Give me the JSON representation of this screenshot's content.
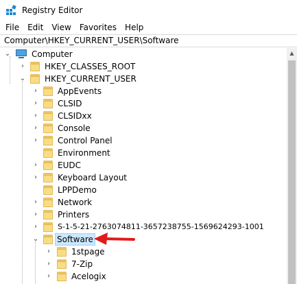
{
  "window": {
    "title": "Registry Editor"
  },
  "menu": [
    "File",
    "Edit",
    "View",
    "Favorites",
    "Help"
  ],
  "address": "Computer\\HKEY_CURRENT_USER\\Software",
  "tree": {
    "root": {
      "label": "Computer",
      "expanded": true
    },
    "hives": [
      {
        "label": "HKEY_CLASSES_ROOT",
        "expanded": false
      },
      {
        "label": "HKEY_CURRENT_USER",
        "expanded": true
      }
    ],
    "hkcu_children": [
      {
        "label": "AppEvents",
        "expanded": false
      },
      {
        "label": "CLSID",
        "expanded": false
      },
      {
        "label": "CLSIDxx",
        "expanded": false
      },
      {
        "label": "Console",
        "expanded": false
      },
      {
        "label": "Control Panel",
        "expanded": false
      },
      {
        "label": "Environment",
        "expanded": false
      },
      {
        "label": "EUDC",
        "expanded": false
      },
      {
        "label": "Keyboard Layout",
        "expanded": false
      },
      {
        "label": "LPPDemo",
        "expanded": false
      },
      {
        "label": "Network",
        "expanded": false
      },
      {
        "label": "Printers",
        "expanded": false
      },
      {
        "label": "S-1-5-21-2763074811-3657238755-1569624293-1001",
        "expanded": false
      },
      {
        "label": "Software",
        "expanded": true,
        "selected": true
      }
    ],
    "software_children": [
      {
        "label": "1stpage",
        "expanded": false
      },
      {
        "label": "7-Zip",
        "expanded": false
      },
      {
        "label": "Acelogix",
        "expanded": false
      }
    ]
  },
  "annotation": {
    "arrow_color": "#e01b1b"
  },
  "colors": {
    "selection_bg": "#cce8ff",
    "folder": "#f9dd84"
  }
}
